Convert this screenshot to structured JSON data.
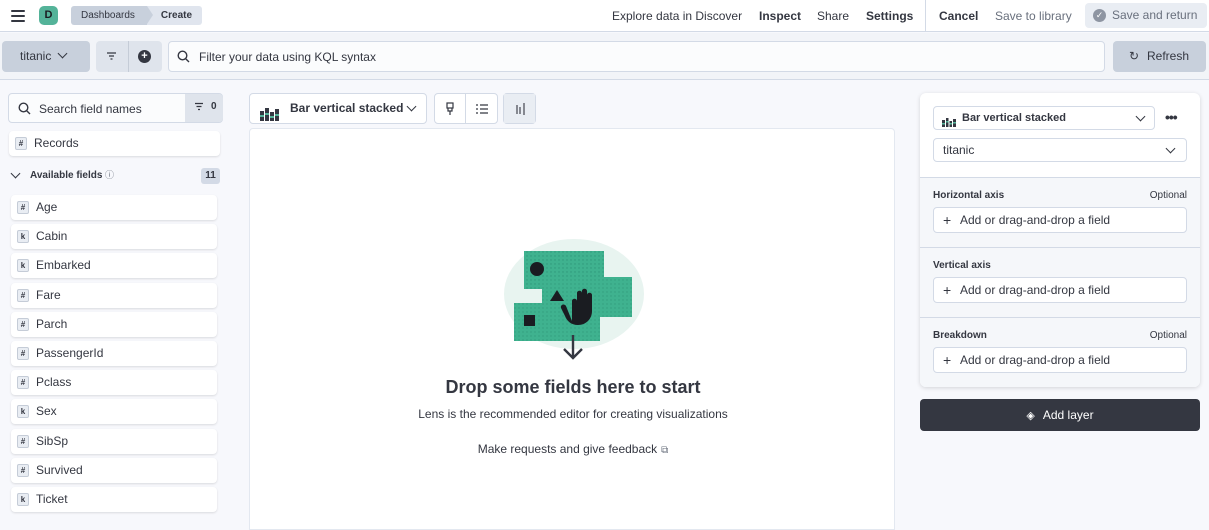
{
  "header": {
    "logo_letter": "D",
    "breadcrumbs": [
      "Dashboards",
      "Create"
    ],
    "links": {
      "explore": "Explore data in Discover",
      "inspect": "Inspect",
      "share": "Share",
      "settings": "Settings",
      "cancel": "Cancel",
      "save_library": "Save to library",
      "save_return": "Save and return"
    }
  },
  "query_bar": {
    "data_view": "titanic",
    "kql_placeholder": "Filter your data using KQL syntax",
    "refresh": "Refresh"
  },
  "field_list": {
    "search_placeholder": "Search field names",
    "filter_count": "0",
    "records_label": "Records",
    "available_label": "Available fields",
    "available_count": "11",
    "fields": [
      {
        "name": "Age",
        "type": "#"
      },
      {
        "name": "Cabin",
        "type": "k"
      },
      {
        "name": "Embarked",
        "type": "k"
      },
      {
        "name": "Fare",
        "type": "#"
      },
      {
        "name": "Parch",
        "type": "#"
      },
      {
        "name": "PassengerId",
        "type": "#"
      },
      {
        "name": "Pclass",
        "type": "#"
      },
      {
        "name": "Sex",
        "type": "k"
      },
      {
        "name": "SibSp",
        "type": "#"
      },
      {
        "name": "Survived",
        "type": "#"
      },
      {
        "name": "Ticket",
        "type": "k"
      }
    ]
  },
  "workspace": {
    "vis_type": "Bar vertical stacked",
    "drop_title": "Drop some fields here to start",
    "drop_subtitle": "Lens is the recommended editor for creating visualizations",
    "feedback_link": "Make requests and give feedback"
  },
  "config_panel": {
    "vis_type": "Bar vertical stacked",
    "data_view": "titanic",
    "dimensions": [
      {
        "label": "Horizontal axis",
        "optional": "Optional",
        "add_label": "Add or drag-and-drop a field"
      },
      {
        "label": "Vertical axis",
        "optional": "",
        "add_label": "Add or drag-and-drop a field"
      },
      {
        "label": "Breakdown",
        "optional": "Optional",
        "add_label": "Add or drag-and-drop a field"
      }
    ],
    "add_layer": "Add layer"
  },
  "colors": {
    "accent_green": "#54b399",
    "dark_button": "#343741",
    "breadcrumb_bg": "#c8d0dc"
  }
}
